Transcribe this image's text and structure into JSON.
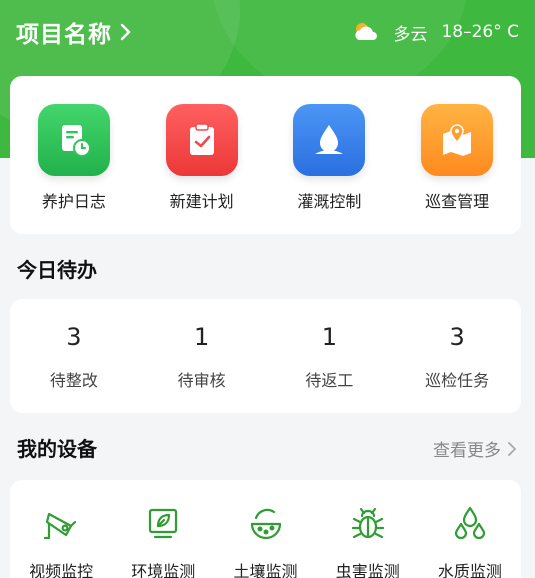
{
  "header": {
    "project_title": "项目名称",
    "weather": {
      "icon": "partly-cloudy-icon",
      "condition": "多云",
      "temperature": "18–26° C"
    }
  },
  "quick_actions": [
    {
      "label": "养护日志",
      "icon": "log-clock-icon",
      "color": "#2ec45a"
    },
    {
      "label": "新建计划",
      "icon": "clipboard-check-icon",
      "color": "#f24a4a"
    },
    {
      "label": "灌溉控制",
      "icon": "water-drop-icon",
      "color": "#2f80ed"
    },
    {
      "label": "巡查管理",
      "icon": "map-pin-icon",
      "color": "#ff9d2e"
    }
  ],
  "todo": {
    "title": "今日待办",
    "items": [
      {
        "count": "3",
        "label": "待整改"
      },
      {
        "count": "1",
        "label": "待审核"
      },
      {
        "count": "1",
        "label": "待返工"
      },
      {
        "count": "3",
        "label": "巡检任务"
      }
    ]
  },
  "devices": {
    "title": "我的设备",
    "see_more": "查看更多",
    "items": [
      {
        "label": "视频监控",
        "icon": "camera-icon"
      },
      {
        "label": "环境监测",
        "icon": "leaf-monitor-icon"
      },
      {
        "label": "土壤监测",
        "icon": "soil-icon"
      },
      {
        "label": "虫害监测",
        "icon": "bug-icon"
      },
      {
        "label": "水质监测",
        "icon": "water-drops-icon"
      }
    ]
  },
  "colors": {
    "brand_green": "#3fb83f",
    "device_icon_green": "#2f9d33"
  }
}
